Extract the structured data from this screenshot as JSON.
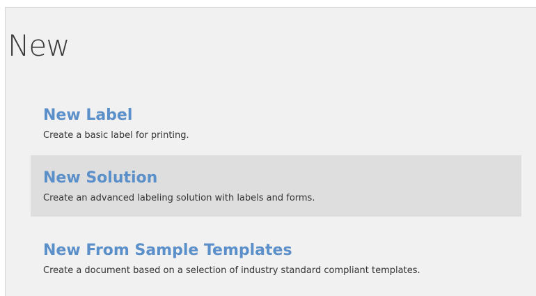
{
  "page": {
    "title": "New"
  },
  "options": [
    {
      "title": "New Label",
      "description": "Create a basic label for printing.",
      "selected": false
    },
    {
      "title": "New Solution",
      "description": "Create an advanced labeling solution with labels and forms.",
      "selected": true
    },
    {
      "title": "New From Sample Templates",
      "description": "Create a document based on a selection of industry standard compliant templates.",
      "selected": false
    }
  ],
  "colors": {
    "panel_background": "#f1f1f1",
    "selected_background": "#dedede",
    "option_title": "#5b8fc9",
    "option_description": "#333333"
  }
}
